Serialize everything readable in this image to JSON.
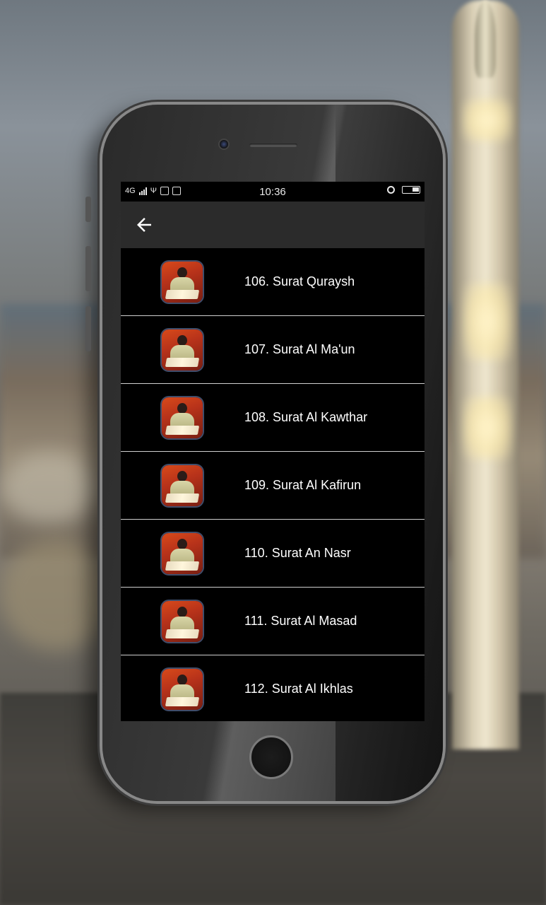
{
  "status_bar": {
    "network": "4G",
    "time": "10:36"
  },
  "app_bar": {
    "back_icon": "arrow-left-icon"
  },
  "surahs": [
    {
      "label": "106. Surat Quraysh"
    },
    {
      "label": "107. Surat Al Ma'un"
    },
    {
      "label": "108. Surat Al Kawthar"
    },
    {
      "label": "109. Surat Al Kafirun"
    },
    {
      "label": "110. Surat An Nasr"
    },
    {
      "label": "111. Surat Al Masad"
    },
    {
      "label": "112. Surat Al Ikhlas"
    }
  ],
  "colors": {
    "app_bar": "#2b2b2b",
    "list_background": "#000000",
    "divider": "#cfcfcf",
    "text": "#ffffff"
  }
}
